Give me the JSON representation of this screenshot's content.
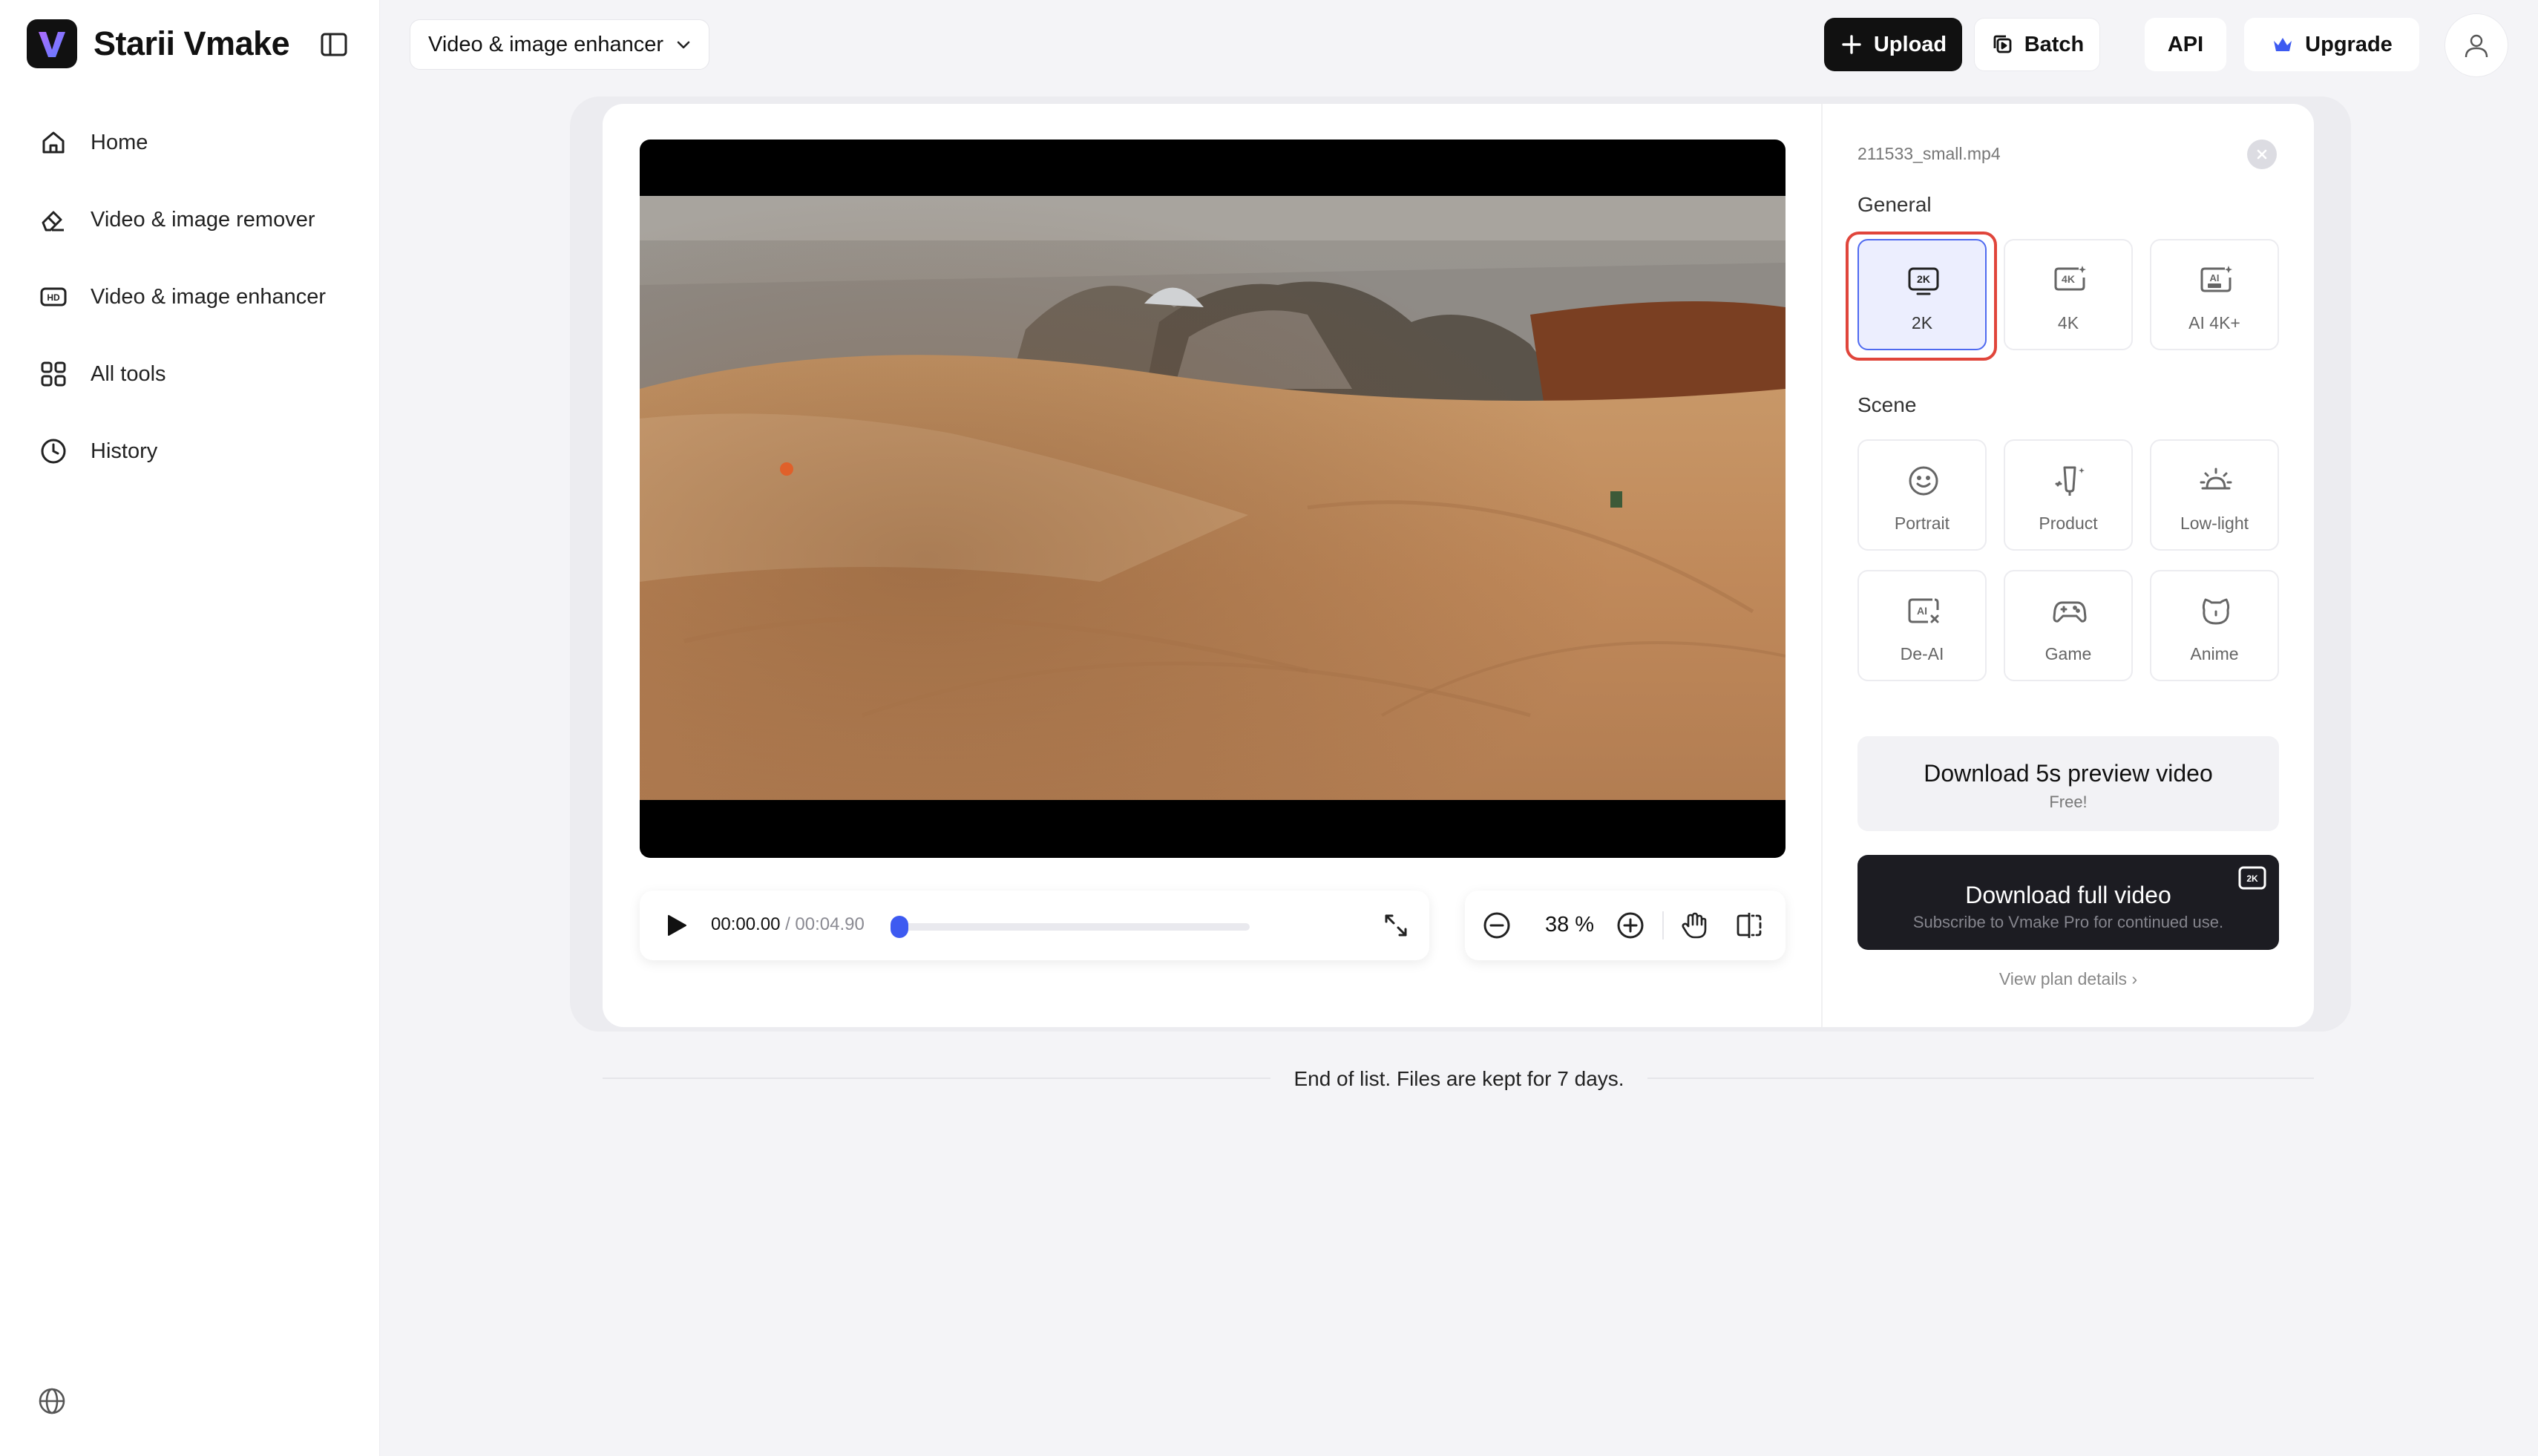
{
  "app": {
    "name": "Starii Vmake"
  },
  "sidebar": {
    "items": [
      {
        "label": "Home",
        "icon": "home-icon"
      },
      {
        "label": "Video & image remover",
        "icon": "eraser-icon"
      },
      {
        "label": "Video & image enhancer",
        "icon": "hd-icon"
      },
      {
        "label": "All tools",
        "icon": "grid-icon"
      },
      {
        "label": "History",
        "icon": "clock-icon"
      }
    ]
  },
  "header": {
    "tool_select": "Video & image enhancer",
    "upload_label": "Upload",
    "batch_label": "Batch",
    "api_label": "API",
    "upgrade_label": "Upgrade"
  },
  "player": {
    "current_time": "00:00.00",
    "duration": "/ 00:04.90",
    "progress": 0,
    "zoom": "38 %"
  },
  "panel": {
    "filename": "211533_small.mp4",
    "general_label": "General",
    "general_options": [
      {
        "label": "2K",
        "icon": "2k-icon",
        "selected": true
      },
      {
        "label": "4K",
        "icon": "4k-icon",
        "selected": false
      },
      {
        "label": "AI 4K+",
        "icon": "ai-ultra-icon",
        "selected": false
      }
    ],
    "scene_label": "Scene",
    "scene_options": [
      {
        "label": "Portrait",
        "icon": "smile-icon"
      },
      {
        "label": "Product",
        "icon": "product-icon"
      },
      {
        "label": "Low-light",
        "icon": "sunrise-icon"
      },
      {
        "label": "De-AI",
        "icon": "de-ai-icon"
      },
      {
        "label": "Game",
        "icon": "gamepad-icon"
      },
      {
        "label": "Anime",
        "icon": "bear-icon"
      }
    ],
    "preview_title": "Download 5s preview video",
    "preview_sub": "Free!",
    "full_title": "Download full video",
    "full_sub": "Subscribe to Vmake Pro for continued use.",
    "plan_link": "View plan details ›"
  },
  "footer": {
    "end_text": "End of list. Files are kept for 7 days."
  },
  "colors": {
    "accent": "#3d5af1",
    "highlight": "#e0453b",
    "dark": "#111111"
  }
}
